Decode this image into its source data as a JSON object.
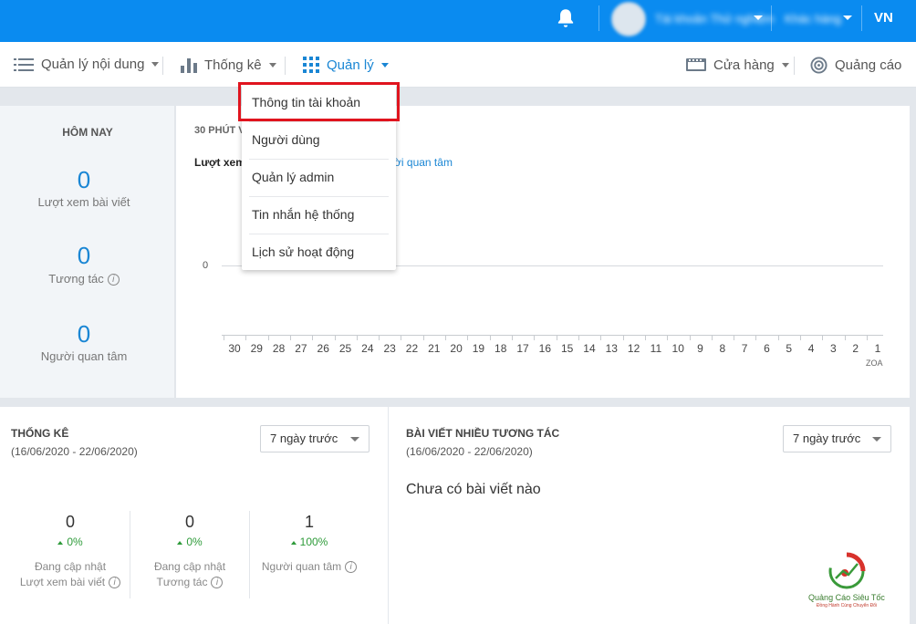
{
  "topbar": {
    "user_name": "Tài khoản Thử nghiệm",
    "org_name": "Khác hàng",
    "lang": "VN"
  },
  "menu": {
    "content": "Quản lý nội dung",
    "stats": "Thống kê",
    "manage": "Quản lý",
    "store": "Cửa hàng",
    "ads": "Quảng cáo"
  },
  "dropdown": {
    "items": [
      "Thông tin tài khoản",
      "Người dùng",
      "Quản lý admin",
      "Tin nhắn hệ thống",
      "Lịch sử hoạt động"
    ],
    "highlight_color": "#e0141e"
  },
  "today": {
    "title": "HÔM NAY",
    "views_value": "0",
    "views_label": "Lượt xem bài viết",
    "interact_value": "0",
    "interact_label": "Tương tác",
    "followers_value": "0",
    "followers_label": "Người quan tâm"
  },
  "chart_panel": {
    "header": "30 PHÚT V",
    "tab_active": "Lượt xem",
    "tab_other": "ười quan tâm",
    "zero": "0",
    "footer": "ZOA"
  },
  "chart_data": {
    "type": "line",
    "x": [
      30,
      29,
      28,
      27,
      26,
      25,
      24,
      23,
      22,
      21,
      20,
      19,
      18,
      17,
      16,
      15,
      14,
      13,
      12,
      11,
      10,
      9,
      8,
      7,
      6,
      5,
      4,
      3,
      2,
      1
    ],
    "x_labels": [
      "30",
      "29",
      "28",
      "27",
      "26",
      "25",
      "24",
      "23",
      "22",
      "21",
      "20",
      "19",
      "18",
      "17",
      "16",
      "15",
      "14",
      "13",
      "12",
      "11",
      "10",
      "9",
      "8",
      "7",
      "6",
      "5",
      "4",
      "3",
      "2",
      "1"
    ],
    "y_ticks": [
      0
    ]
  },
  "stats_panel": {
    "title": "THỐNG KÊ",
    "date_range": "(16/06/2020 - 22/06/2020)",
    "select_value": "7 ngày trước",
    "items": [
      {
        "value": "0",
        "pct": "0%",
        "label1": "Đang cập nhật",
        "label2": "Lượt xem bài viết"
      },
      {
        "value": "0",
        "pct": "0%",
        "label1": "Đang cập nhật",
        "label2": "Tương tác"
      },
      {
        "value": "1",
        "pct": "100%",
        "label1": "Người quan tâm",
        "label2": ""
      }
    ]
  },
  "posts_panel": {
    "title": "BÀI VIẾT NHIỀU TƯƠNG TÁC",
    "date_range": "(16/06/2020 - 22/06/2020)",
    "select_value": "7 ngày trước",
    "empty": "Chưa có bài viết nào"
  },
  "watermark": {
    "name": "Quảng Cáo Siêu Tốc",
    "slogan": "Đồng Hành Cùng Chuyển Đổi"
  }
}
